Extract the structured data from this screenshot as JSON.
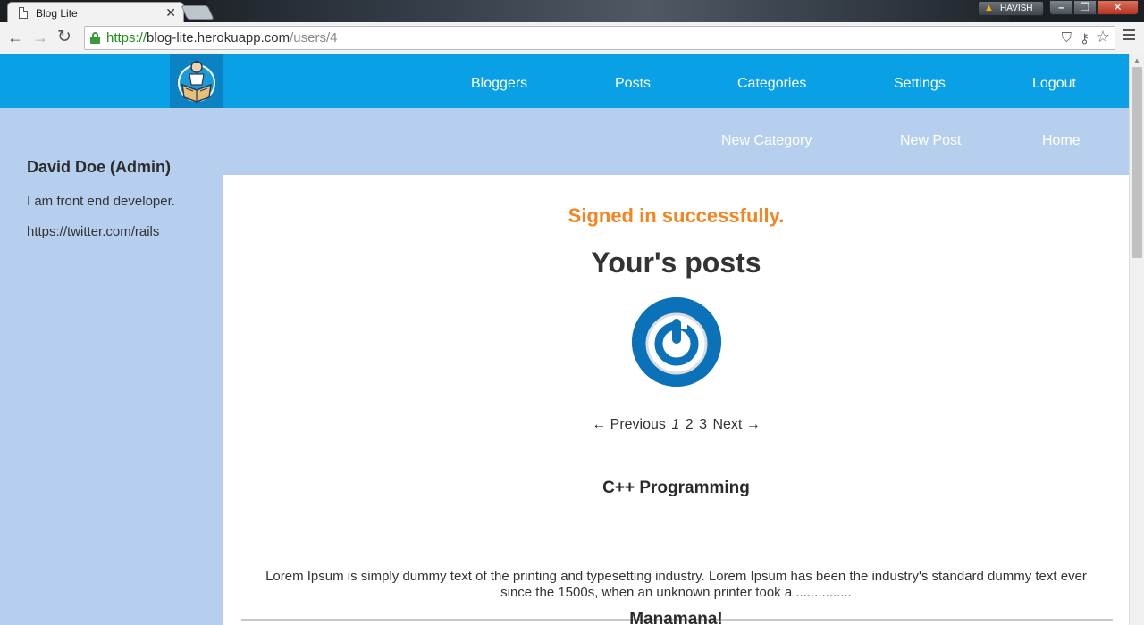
{
  "browser": {
    "tab_title": "Blog Lite",
    "tab_close": "✕",
    "profile_badge": "HAVISH",
    "url_scheme": "https://",
    "url_host": "blog-lite.herokuapp.com",
    "url_path": "/users/4"
  },
  "nav": {
    "links": [
      "Bloggers",
      "Posts",
      "Categories",
      "Settings",
      "Logout"
    ]
  },
  "subnav": {
    "links": [
      "New Category",
      "New Post",
      "Home"
    ]
  },
  "sidebar": {
    "name": "David Doe (Admin)",
    "bio": "I am front end developer.",
    "twitter": "https://twitter.com/rails"
  },
  "main": {
    "flash": "Signed in successfully.",
    "heading": "Your's posts",
    "pagination": {
      "prev": "← Previous",
      "pages": [
        "1",
        "2",
        "3"
      ],
      "current": "1",
      "next": "Next →"
    },
    "posts": [
      {
        "title": "C++ Programming",
        "excerpt": "Lorem Ipsum is simply dummy text of the printing and typesetting industry. Lorem Ipsum has been the industry's standard dummy text ever since the 1500s, when an unknown printer took a ..............."
      },
      {
        "title": "Manamana!"
      }
    ]
  },
  "colors": {
    "topnav": "#0aa0e6",
    "page_bg": "#b7cfee",
    "flash": "#f5841f"
  },
  "icons": {
    "logo": "blogger-logo-icon",
    "avatar": "power-avatar-icon"
  }
}
